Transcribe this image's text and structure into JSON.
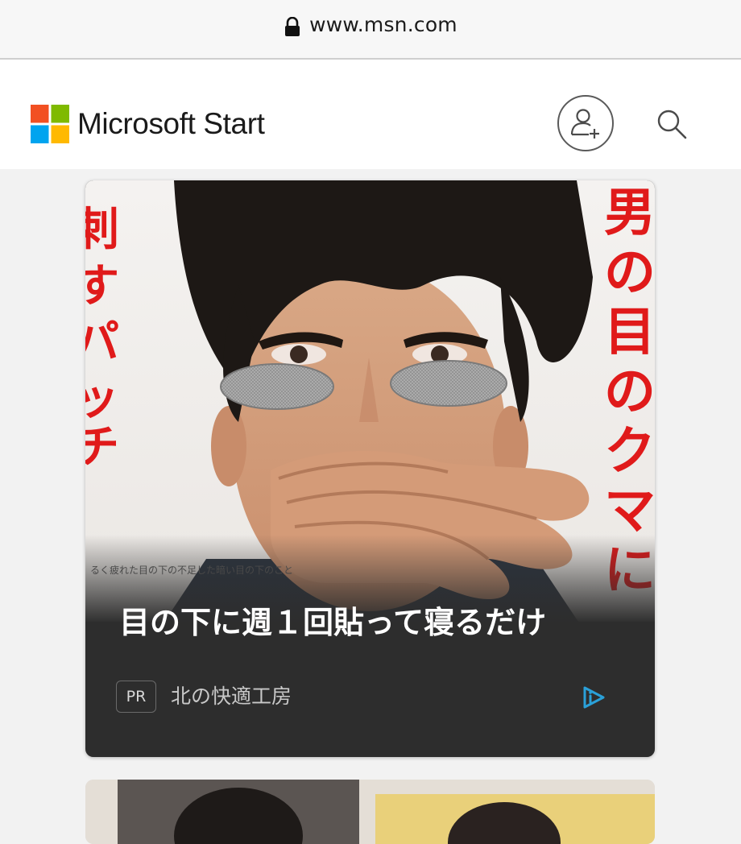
{
  "browser": {
    "url": "www.msn.com",
    "lock_icon": "lock-icon"
  },
  "header": {
    "brand": "Microsoft Start",
    "logo_icon": "microsoft-logo-icon",
    "logo_colors": [
      "#f25022",
      "#7fba00",
      "#00a4ef",
      "#ffb900"
    ],
    "add_account_icon": "add-person-icon",
    "search_icon": "search-icon"
  },
  "ad_card": {
    "headline": "目の下に週１回貼って寝るだけ",
    "badge": "PR",
    "sponsor": "北の快適工房",
    "adchoices_icon": "adchoices-icon",
    "accent_color": "#2aa0d8",
    "image_overlay_text": {
      "right_vertical": "男の目のクマに",
      "left_vertical": "刺すパッチ",
      "small_caption": "るく疲れた目の下の不足した暗い目の下のこと"
    }
  }
}
